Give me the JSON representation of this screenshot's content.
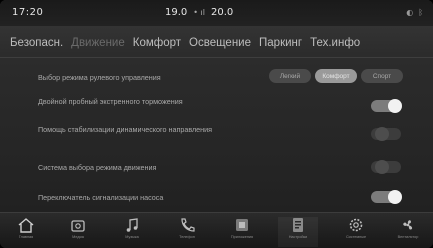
{
  "status": {
    "time": "17:20",
    "temp_left": "19.0",
    "temp_right": "20.0"
  },
  "tabs": [
    {
      "label": "Безопасн."
    },
    {
      "label": "Движение"
    },
    {
      "label": "Комфорт"
    },
    {
      "label": "Освещение"
    },
    {
      "label": "Паркинг"
    },
    {
      "label": "Тех.инфо"
    }
  ],
  "settings": {
    "steering_mode": {
      "label": "Выбор режима рулевого управления",
      "options": [
        "Легкий",
        "Комфорт",
        "Спорт"
      ],
      "selected": "Комфорт"
    },
    "dual_brake": {
      "label": "Двойной пробный экстренного торможения",
      "on": true
    },
    "stability": {
      "label": "Помощь стабилизации динамического направления",
      "on": false
    },
    "drive_mode": {
      "label": "Система выбора режима движения",
      "on": false
    },
    "pump_switch": {
      "label": "Переключатель сигнализации насоса",
      "on": true
    }
  },
  "dock": {
    "items": [
      {
        "label": "Главная",
        "icon": "home-icon"
      },
      {
        "label": "Медиа",
        "icon": "media-icon"
      },
      {
        "label": "Музыка",
        "icon": "music-note-icon"
      },
      {
        "label": "Телефон",
        "icon": "phone-icon"
      },
      {
        "label": "Приложения",
        "icon": "apps-icon"
      },
      {
        "label": "Настройки",
        "icon": "settings-car-icon"
      },
      {
        "label": "Системные",
        "icon": "gear-icon"
      },
      {
        "label": "Вентилятор",
        "icon": "fan-icon"
      }
    ]
  }
}
